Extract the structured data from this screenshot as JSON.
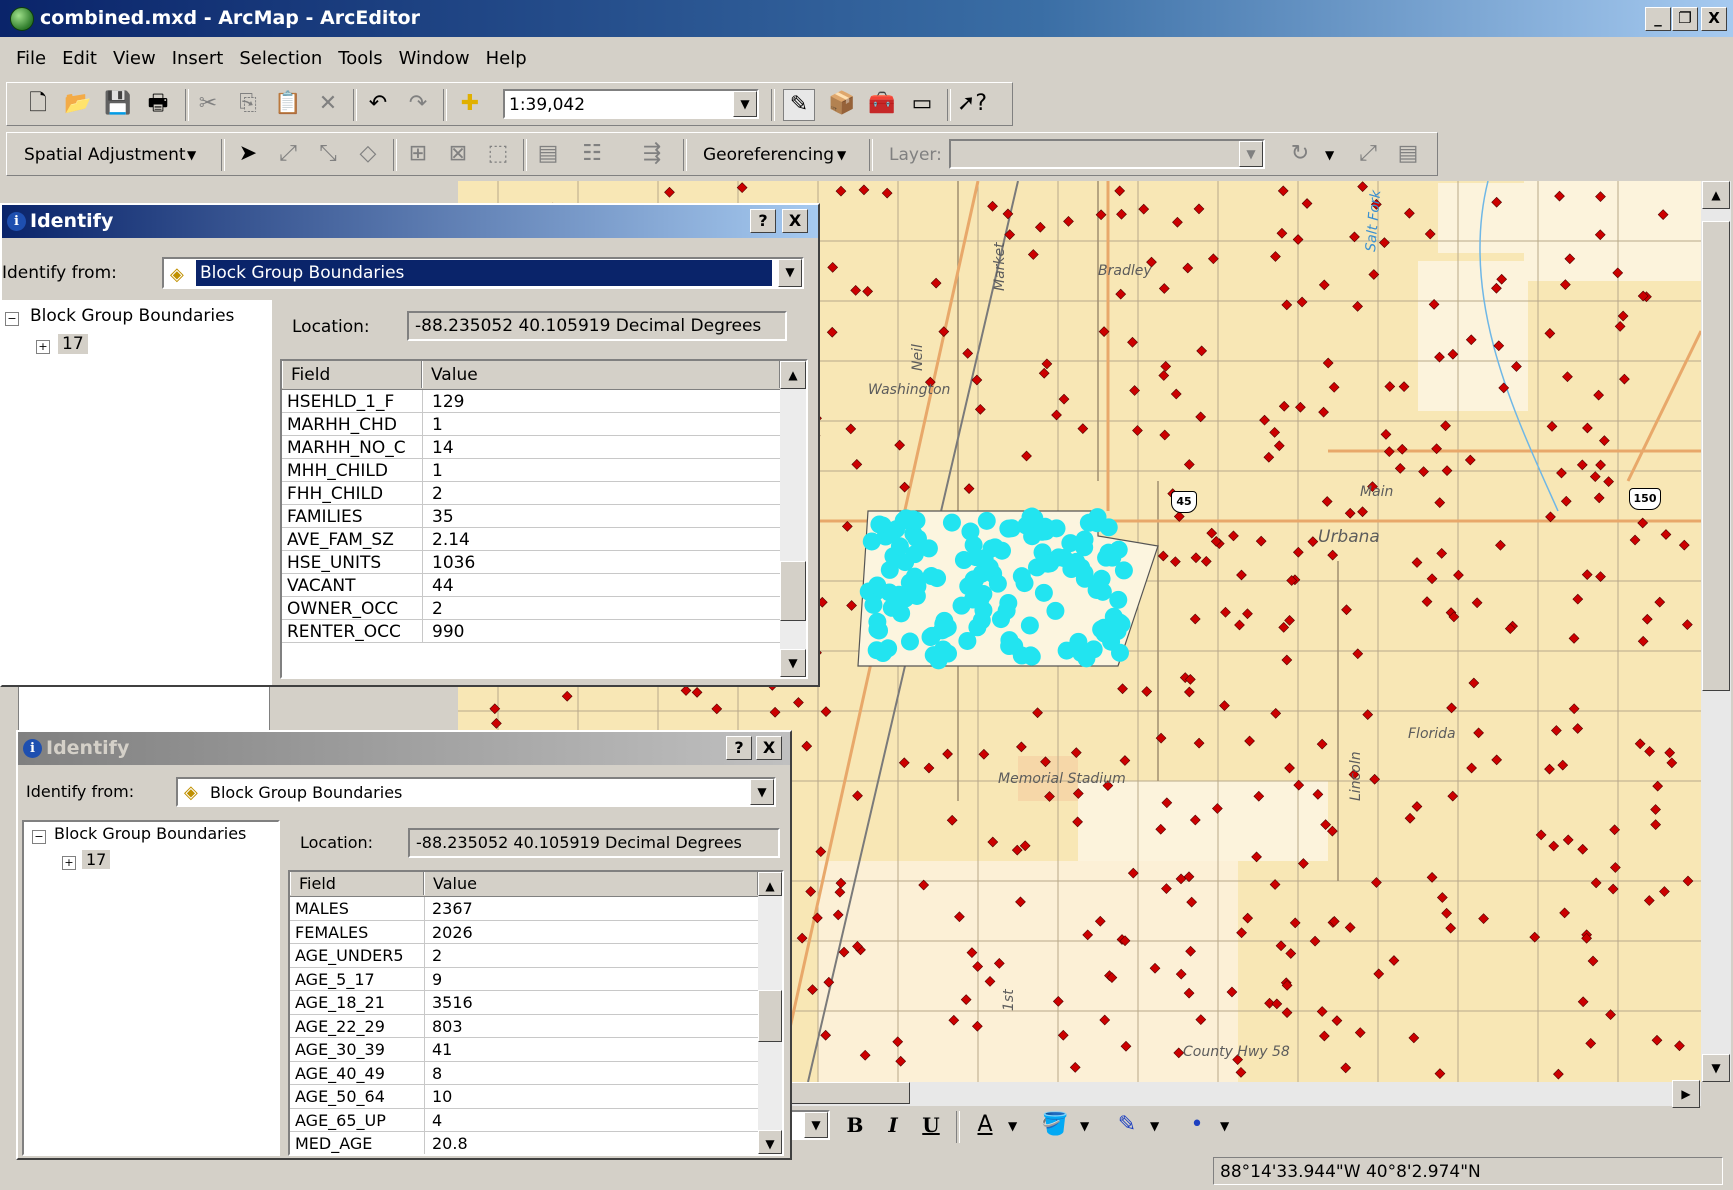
{
  "window": {
    "title": "combined.mxd - ArcMap - ArcEditor",
    "minimize": "_",
    "restore": "Ŗ",
    "close": "X"
  },
  "menu": [
    "File",
    "Edit",
    "View",
    "Insert",
    "Selection",
    "Tools",
    "Window",
    "Help"
  ],
  "standard_toolbar": {
    "scale": "1:39,042"
  },
  "editor_toolbar": {
    "spatial_adjustment": "Spatial Adjustment",
    "georeferencing": "Georeferencing",
    "layer_label": "Layer:",
    "layer_value": ""
  },
  "map": {
    "labels": {
      "washington": "Washington",
      "bradley": "Bradley",
      "salt_fork": "Salt Fork",
      "main": "Main",
      "urbana": "Urbana",
      "florida": "Florida",
      "memorial": "Memorial Stadium",
      "county_hwy": "County Hwy 58",
      "lincoln": "Lincoln",
      "neil": "Neil",
      "market": "Market",
      "first": "1st"
    },
    "shields": {
      "us45": "45",
      "us150": "150"
    }
  },
  "identify1": {
    "title": "Identify",
    "help": "?",
    "close": "X",
    "from_label": "Identify from:",
    "from_value": "Block Group Boundaries",
    "tree_root": "Block Group Boundaries",
    "tree_child": "17",
    "location_label": "Location:",
    "location_value": "-88.235052  40.105919 Decimal Degrees",
    "col_field": "Field",
    "col_value": "Value",
    "rows": [
      {
        "field": "HSEHLD_1_F",
        "value": "129"
      },
      {
        "field": "MARHH_CHD",
        "value": "1"
      },
      {
        "field": "MARHH_NO_C",
        "value": "14"
      },
      {
        "field": "MHH_CHILD",
        "value": "1"
      },
      {
        "field": "FHH_CHILD",
        "value": "2"
      },
      {
        "field": "FAMILIES",
        "value": "35"
      },
      {
        "field": "AVE_FAM_SZ",
        "value": "2.14"
      },
      {
        "field": "HSE_UNITS",
        "value": "1036"
      },
      {
        "field": "VACANT",
        "value": "44"
      },
      {
        "field": "OWNER_OCC",
        "value": "2"
      },
      {
        "field": "RENTER_OCC",
        "value": "990"
      }
    ]
  },
  "identify2": {
    "title": "Identify",
    "help": "?",
    "close": "X",
    "from_label": "Identify from:",
    "from_value": "Block Group Boundaries",
    "tree_root": "Block Group Boundaries",
    "tree_child": "17",
    "location_label": "Location:",
    "location_value": "-88.235052  40.105919 Decimal Degrees",
    "col_field": "Field",
    "col_value": "Value",
    "rows": [
      {
        "field": "MALES",
        "value": "2367"
      },
      {
        "field": "FEMALES",
        "value": "2026"
      },
      {
        "field": "AGE_UNDER5",
        "value": "2"
      },
      {
        "field": "AGE_5_17",
        "value": "9"
      },
      {
        "field": "AGE_18_21",
        "value": "3516"
      },
      {
        "field": "AGE_22_29",
        "value": "803"
      },
      {
        "field": "AGE_30_39",
        "value": "41"
      },
      {
        "field": "AGE_40_49",
        "value": "8"
      },
      {
        "field": "AGE_50_64",
        "value": "10"
      },
      {
        "field": "AGE_65_UP",
        "value": "4"
      },
      {
        "field": "MED_AGE",
        "value": "20.8"
      }
    ]
  },
  "draw_toolbar": {
    "bold": "B",
    "italic": "I",
    "underline": "U"
  },
  "status": {
    "coords": "88°14'33.944\"W  40°8'2.974\"N"
  },
  "colors": {
    "map_bg": "#f8e7b5",
    "points": "#cc0000",
    "selected": "#22e4f0",
    "title_active": "#0a246a"
  }
}
